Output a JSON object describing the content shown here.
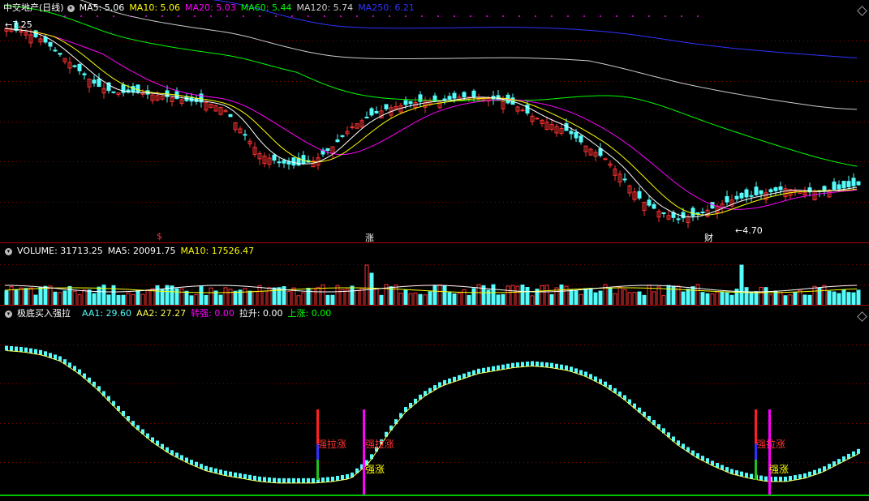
{
  "colors": {
    "up": "#ff3232",
    "down": "#54fcfc",
    "ma5": "#ffffff",
    "ma10": "#ffff00",
    "ma20": "#ff00ff",
    "ma60": "#00ff00",
    "ma120": "#cccccc",
    "ma250": "#3232ff",
    "grid": "#800000",
    "aa2": "#ffff55",
    "strong": "#ff3232",
    "rise": "#00c000"
  },
  "price_panel": {
    "title": "中交地产(日线)",
    "indicators": [
      {
        "label": "MA5: 5.06",
        "color": "#ffffff"
      },
      {
        "label": "MA10: 5.06",
        "color": "#ffff00"
      },
      {
        "label": "MA20: 5.03",
        "color": "#ff00ff"
      },
      {
        "label": "MA60: 5.44",
        "color": "#00ff00"
      },
      {
        "label": "MA120: 5.74",
        "color": "#cccccc"
      },
      {
        "label": "MA250: 6.21",
        "color": "#3232ff"
      }
    ],
    "high_label": "7.25",
    "low_label": "4.70",
    "markers": [
      {
        "text": "$",
        "color": "#ff3232",
        "value": 0.18
      },
      {
        "text": "涨",
        "color": "#ffffff",
        "value": 0.42
      },
      {
        "text": "财",
        "color": "#ffffff",
        "value": 0.81
      }
    ]
  },
  "volume_panel": {
    "indicators": [
      {
        "label": "VOLUME: 31713.25",
        "color": "#ffffff"
      },
      {
        "label": "MA5: 20091.75",
        "color": "#ffffff"
      },
      {
        "label": "MA10: 17526.47",
        "color": "#ffff00"
      }
    ]
  },
  "indicator_panel": {
    "title": "极底买入强拉",
    "indicators": [
      {
        "label": "AA1: 29.60",
        "color": "#54fcfc"
      },
      {
        "label": "AA2: 27.27",
        "color": "#ffff55"
      },
      {
        "label": "转强: 0.00",
        "color": "#ff00ff"
      },
      {
        "label": "拉升: 0.00",
        "color": "#ffffff"
      },
      {
        "label": "上涨: 0.00",
        "color": "#00ff00"
      }
    ],
    "signals": [
      {
        "text": "强拉涨",
        "color": "#ff3232",
        "pos": 0.365
      },
      {
        "text": "强拉涨",
        "color": "#ff3232",
        "pos": 0.42
      },
      {
        "text": "强涨",
        "color": "#ffff00",
        "pos": 0.42
      },
      {
        "text": "强拉涨",
        "color": "#ff3232",
        "pos": 0.87
      },
      {
        "text": "强涨",
        "color": "#ffff00",
        "pos": 0.885
      }
    ]
  },
  "chart_data": {
    "type": "candlestick",
    "series_count": 1,
    "price_range": [
      4.7,
      7.25
    ],
    "close_curve": [
      7.25,
      7.2,
      7.1,
      6.9,
      6.7,
      6.5,
      6.4,
      6.42,
      6.38,
      6.35,
      6.3,
      6.28,
      6.2,
      5.9,
      5.6,
      5.5,
      5.45,
      5.52,
      5.7,
      5.95,
      6.1,
      6.2,
      6.25,
      6.3,
      6.3,
      6.35,
      6.35,
      6.32,
      6.25,
      6.1,
      6.0,
      5.9,
      5.7,
      5.55,
      5.3,
      5.0,
      4.85,
      4.75,
      4.8,
      4.9,
      5.0,
      5.05,
      5.1,
      5.15,
      5.1,
      5.12,
      5.15,
      5.2
    ],
    "aa1_curve": [
      95,
      94,
      92,
      88,
      80,
      70,
      58,
      46,
      36,
      28,
      22,
      17,
      14,
      12,
      10,
      9,
      9,
      9,
      10,
      12,
      22,
      40,
      55,
      65,
      72,
      76,
      80,
      82,
      84,
      85,
      84,
      82,
      78,
      72,
      64,
      54,
      44,
      34,
      26,
      20,
      15,
      12,
      10,
      10,
      12,
      16,
      22,
      28
    ]
  }
}
